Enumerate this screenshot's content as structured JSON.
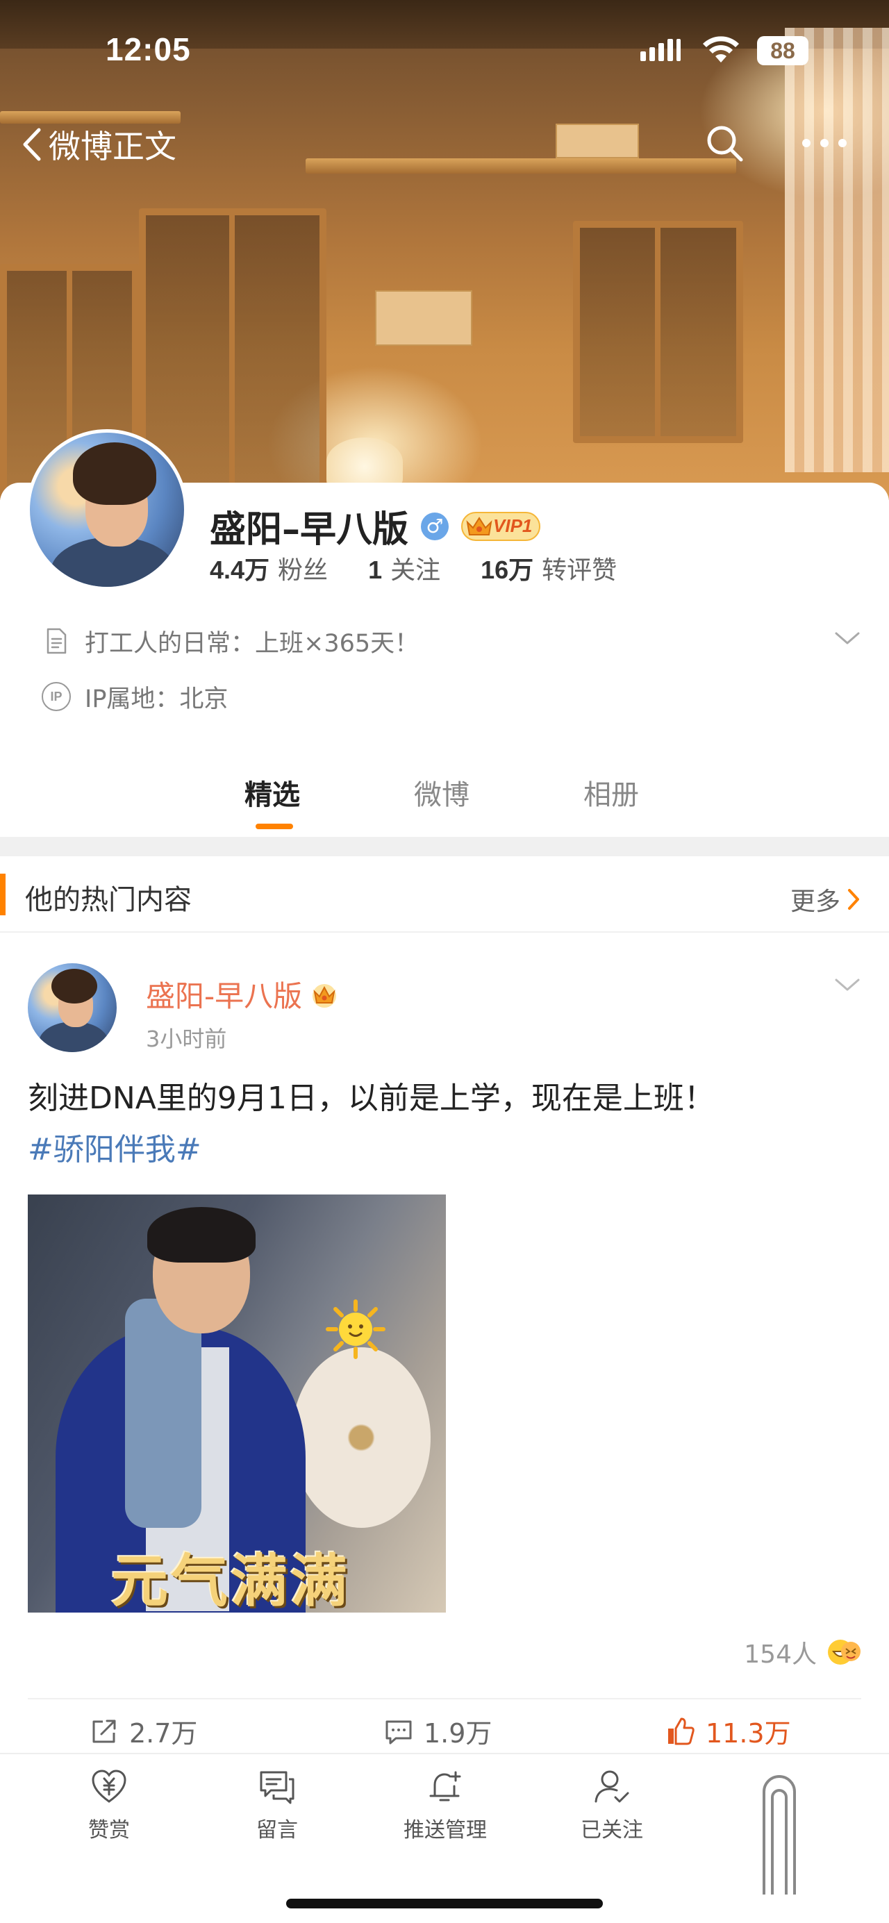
{
  "status_bar": {
    "time": "12:05",
    "battery": "88"
  },
  "nav": {
    "back_label": "微博正文"
  },
  "profile": {
    "name": "盛阳–早八版",
    "gender_symbol": "♂",
    "vip_label": "VIP1",
    "stats": [
      {
        "value": "4.4万",
        "label": "粉丝"
      },
      {
        "value": "1",
        "label": "关注"
      },
      {
        "value": "16万",
        "label": "转评赞"
      }
    ],
    "bio": "打工人的日常：上班×365天！",
    "ip": "IP属地：北京",
    "ip_badge": "IP"
  },
  "tabs": [
    "精选",
    "微博",
    "相册"
  ],
  "hot_section": {
    "title": "他的热门内容",
    "more_label": "更多"
  },
  "post": {
    "author": "盛阳-早八版",
    "time": "3小时前",
    "text": "刻进DNA里的9月1日，以前是上学，现在是上班！",
    "hashtag": "#骄阳伴我#",
    "image_caption": "元气满满",
    "reaction_count": "154人",
    "reposts": "2.7万",
    "comments": "1.9万",
    "likes": "11.3万"
  },
  "bottom_bar": [
    {
      "label": "赞赏",
      "icon": "reward-icon"
    },
    {
      "label": "留言",
      "icon": "message-icon"
    },
    {
      "label": "推送管理",
      "icon": "bell-plus-icon"
    },
    {
      "label": "已关注",
      "icon": "user-check-icon"
    }
  ],
  "colors": {
    "accent": "#ff8200",
    "author": "#eb7350",
    "hashtag": "#4a7ab8",
    "like": "#e2571e"
  }
}
